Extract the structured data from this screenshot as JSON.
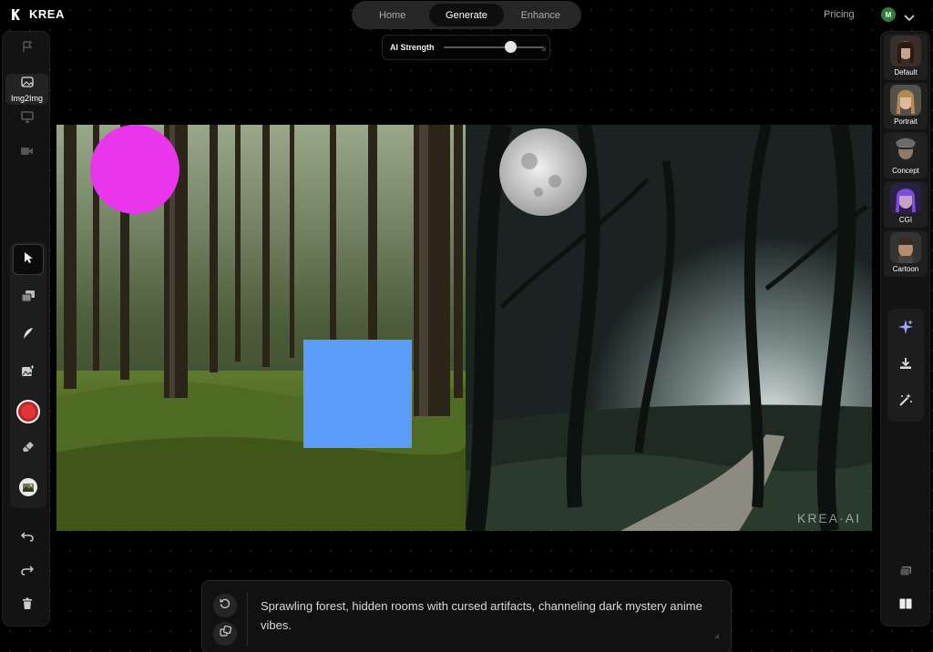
{
  "app": {
    "name": "KREA"
  },
  "nav": {
    "tabs": [
      {
        "label": "Home"
      },
      {
        "label": "Generate"
      },
      {
        "label": "Enhance"
      }
    ],
    "active": "Generate",
    "pricing_label": "Pricing",
    "avatar_initial": "M"
  },
  "strength": {
    "label": "AI Strength",
    "value_fraction": 0.67
  },
  "left_toolbar": {
    "active_mode_label": "Img2Img",
    "brush_color": "#e0363a"
  },
  "canvas": {
    "shapes": {
      "circle_color": "#e935ec",
      "square_color": "#5b9cf8"
    },
    "watermark": "KREA·AI"
  },
  "styles": [
    {
      "label": "Default"
    },
    {
      "label": "Portrait"
    },
    {
      "label": "Concept"
    },
    {
      "label": "CGI"
    },
    {
      "label": "Cartoon"
    }
  ],
  "prompt": {
    "text": "Sprawling forest, hidden rooms with cursed artifacts, channeling dark mystery anime vibes."
  }
}
